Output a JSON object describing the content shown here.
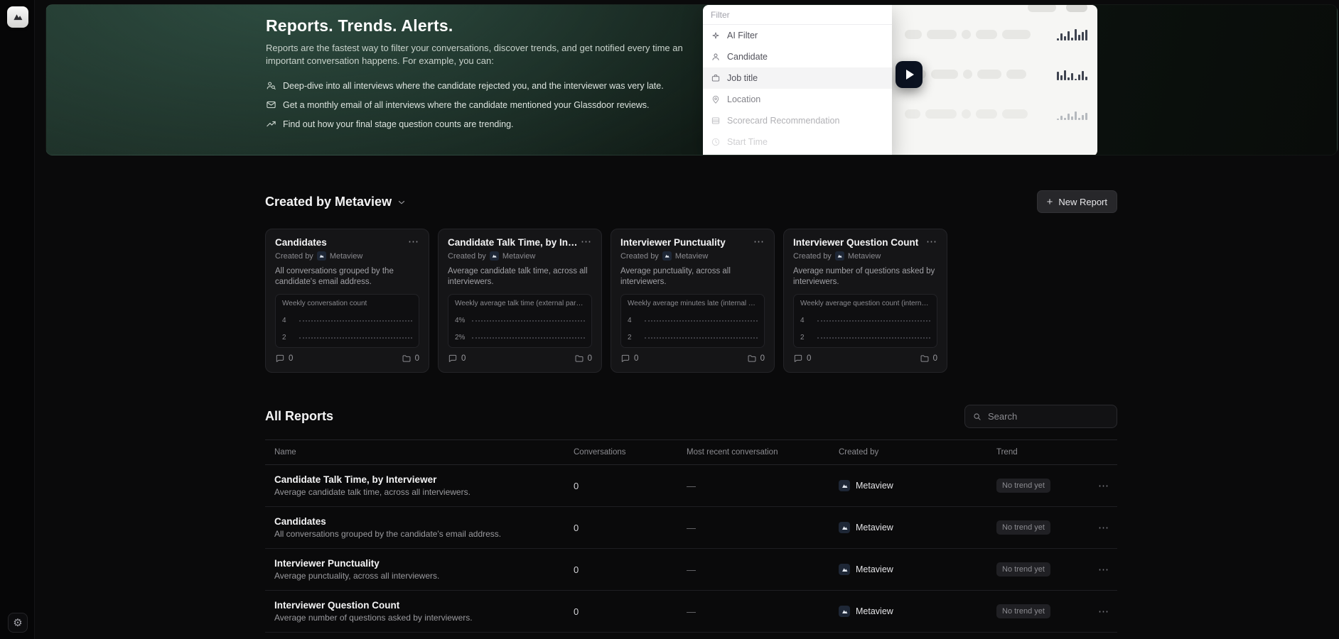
{
  "app": {
    "name": "Metaview"
  },
  "hero": {
    "title": "Reports. Trends. Alerts.",
    "description": "Reports are the fastest way to filter your conversations, discover trends, and get notified every time an important conversation happens. For example, you can:",
    "bullets": [
      {
        "icon": "user-search-icon",
        "text": "Deep-dive into all interviews where the candidate rejected you, and the interviewer was very late."
      },
      {
        "icon": "mail-icon",
        "text": "Get a monthly email of all interviews where the candidate mentioned your Glassdoor reviews."
      },
      {
        "icon": "trending-up-icon",
        "text": "Find out how your final stage question counts are trending."
      }
    ],
    "filter_panel": {
      "placeholder": "Filter",
      "items": [
        {
          "icon": "sparkles-icon",
          "label": "AI Filter"
        },
        {
          "icon": "user-icon",
          "label": "Candidate"
        },
        {
          "icon": "briefcase-icon",
          "label": "Job title",
          "highlighted": true
        },
        {
          "icon": "map-pin-icon",
          "label": "Location"
        },
        {
          "icon": "rows-icon",
          "label": "Scorecard Recommendation"
        },
        {
          "icon": "clock-icon",
          "label": "Start Time"
        }
      ]
    }
  },
  "created_section": {
    "title": "Created by Metaview",
    "new_report_button": "New Report"
  },
  "cards": [
    {
      "title": "Candidates",
      "created_by_label": "Created by",
      "creator": "Metaview",
      "description": "All conversations grouped by the candidate's email address.",
      "chart_title": "Weekly conversation count",
      "y_labels": [
        "4",
        "2"
      ],
      "conversation_count": "0",
      "folder_count": "0"
    },
    {
      "title": "Candidate Talk Time, by Interviewer",
      "created_by_label": "Created by",
      "creator": "Metaview",
      "description": "Average candidate talk time, across all interviewers.",
      "chart_title": "Weekly average talk time (external par…",
      "y_labels": [
        "4%",
        "2%"
      ],
      "conversation_count": "0",
      "folder_count": "0"
    },
    {
      "title": "Interviewer Punctuality",
      "created_by_label": "Created by",
      "creator": "Metaview",
      "description": "Average punctuality, across all interviewers.",
      "chart_title": "Weekly average minutes late (internal …",
      "y_labels": [
        "4",
        "2"
      ],
      "conversation_count": "0",
      "folder_count": "0"
    },
    {
      "title": "Interviewer Question Count",
      "created_by_label": "Created by",
      "creator": "Metaview",
      "description": "Average number of questions asked by interviewers.",
      "chart_title": "Weekly average question count (intern…",
      "y_labels": [
        "4",
        "2"
      ],
      "conversation_count": "0",
      "folder_count": "0"
    }
  ],
  "all_reports": {
    "title": "All Reports",
    "search_placeholder": "Search",
    "columns": [
      "Name",
      "Conversations",
      "Most recent conversation",
      "Created by",
      "Trend"
    ],
    "rows": [
      {
        "name": "Candidate Talk Time, by Interviewer",
        "description": "Average candidate talk time, across all interviewers.",
        "conversations": "0",
        "most_recent": "—",
        "created_by": "Metaview",
        "trend": "No trend yet"
      },
      {
        "name": "Candidates",
        "description": "All conversations grouped by the candidate's email address.",
        "conversations": "0",
        "most_recent": "—",
        "created_by": "Metaview",
        "trend": "No trend yet"
      },
      {
        "name": "Interviewer Punctuality",
        "description": "Average punctuality, across all interviewers.",
        "conversations": "0",
        "most_recent": "—",
        "created_by": "Metaview",
        "trend": "No trend yet"
      },
      {
        "name": "Interviewer Question Count",
        "description": "Average number of questions asked by interviewers.",
        "conversations": "0",
        "most_recent": "—",
        "created_by": "Metaview",
        "trend": "No trend yet"
      }
    ]
  }
}
